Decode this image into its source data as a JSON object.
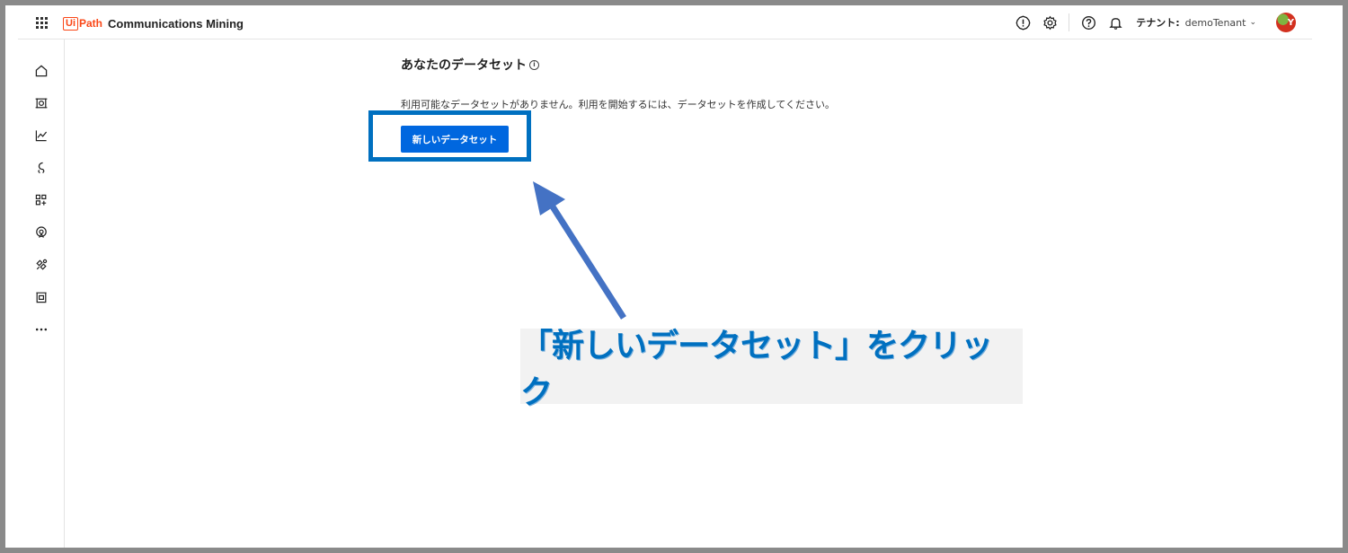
{
  "header": {
    "logo_ui": "Ui",
    "logo_path": "Path",
    "product": "Communications Mining",
    "tenant_label": "テナント:",
    "tenant_value": "demoTenant",
    "avatar_initial": "Y"
  },
  "sidebar": {
    "items": [
      {
        "icon": "home-icon"
      },
      {
        "icon": "dataset-icon"
      },
      {
        "icon": "chart-icon"
      },
      {
        "icon": "streams-icon"
      },
      {
        "icon": "apps-add-icon"
      },
      {
        "icon": "source-icon"
      },
      {
        "icon": "integrations-icon"
      },
      {
        "icon": "building-icon"
      },
      {
        "icon": "more-icon"
      }
    ]
  },
  "main": {
    "title": "あなたのデータセット",
    "info_glyph": "i",
    "empty_message": "利用可能なデータセットがありません。利用を開始するには、データセットを作成してください。",
    "new_dataset_button": "新しいデータセット"
  },
  "annotation": {
    "callout_text": "「新しいデータセット」をクリック",
    "accent_color": "#0070c0"
  }
}
